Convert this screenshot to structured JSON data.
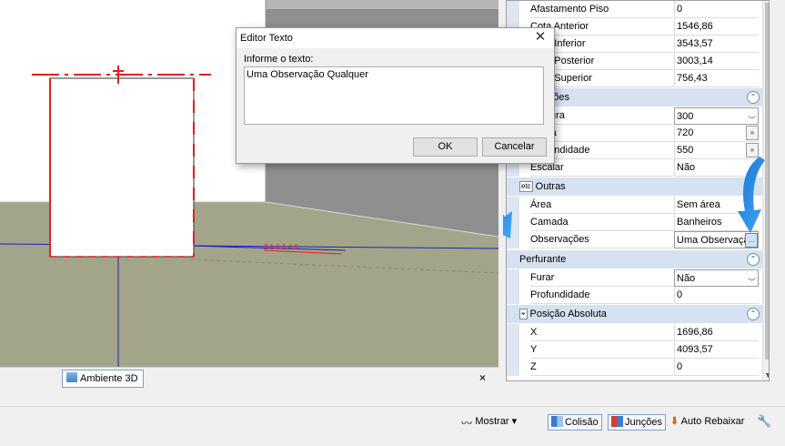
{
  "dialog": {
    "title": "Editor Texto",
    "close_glyph": "✕",
    "prompt": "Informe o texto:",
    "text_value": "Uma Observação Qualquer",
    "ok_label": "OK",
    "cancel_label": "Cancelar"
  },
  "viewport": {
    "dimension_label": "2 1 6 1 4 0"
  },
  "properties": {
    "rows_top": [
      {
        "label": "Afastamento Piso",
        "value": "0"
      },
      {
        "label": "Cota Anterior",
        "value": "1546,86"
      },
      {
        "label": "Cota Inferior",
        "value": "3543,57"
      },
      {
        "label": "Cota Posterior",
        "value": "3003,14"
      },
      {
        "label": "Cota Superior",
        "value": "756,43"
      }
    ],
    "cat_dimensoes": "Dimensões",
    "rows_dimensoes": [
      {
        "label": "Largura",
        "value": "300"
      },
      {
        "label": "Altura",
        "value": "720"
      },
      {
        "label": "Profundidade",
        "value": "550"
      },
      {
        "label": "Escalar",
        "value": "Não"
      }
    ],
    "cat_outras": "Outras",
    "cat_outras_icon": "etc",
    "rows_outras": [
      {
        "label": "Área",
        "value": "Sem área"
      },
      {
        "label": "Camada",
        "value": "Banheiros"
      },
      {
        "label": "Observações",
        "value": "Uma Observação"
      }
    ],
    "cat_perfurante": "Perfurante",
    "rows_perfurante": [
      {
        "label": "Furar",
        "value": "Não"
      },
      {
        "label": "Profundidade",
        "value": "0"
      }
    ],
    "cat_posicao": "Posição Absoluta",
    "rows_posicao": [
      {
        "label": "X",
        "value": "1696,86"
      },
      {
        "label": "Y",
        "value": "4093,57"
      },
      {
        "label": "Z",
        "value": "0"
      }
    ],
    "collapse_glyph": "⌃",
    "ellipsis": "...",
    "more_glyph": "»",
    "dropdown_glyph": "﹀"
  },
  "tabs": {
    "ambiente_label": "Ambiente 3D",
    "close_glyph": "×"
  },
  "statusbar": {
    "mostrar": "Mostrar",
    "mostrar_arrow": "▾",
    "colisao": "Colisão",
    "juncoes": "Junções",
    "auto_rebaixar": "Auto Rebaixar"
  },
  "colors": {
    "accent_blue": "#1e88e5",
    "dimension_red": "#e02020",
    "floor": "#a3a58a",
    "category_bg": "#d6e2f1"
  }
}
